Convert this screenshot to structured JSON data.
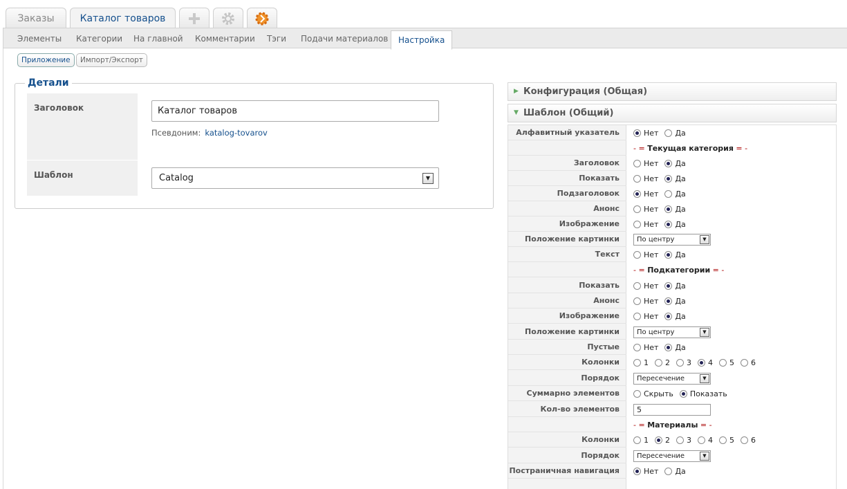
{
  "app_tabs": {
    "orders": "Заказы",
    "catalog": "Каталог товаров"
  },
  "subnav": [
    "Элементы",
    "Категории",
    "На главной",
    "Комментарии",
    "Тэги",
    "Подачи материалов",
    "Настройка"
  ],
  "pills": {
    "app": "Приложение",
    "import": "Импорт/Экспорт"
  },
  "details": {
    "legend": "Детали",
    "title_label": "Заголовок",
    "title_value": "Каталог товаров",
    "alias_label": "Псевдоним:",
    "alias_value": "katalog-tovarov",
    "template_label": "Шаблон",
    "template_value": "Catalog"
  },
  "accordion": {
    "config": "Конфигурация (Общая)",
    "template": "Шаблон (Общий)"
  },
  "sections": {
    "current": "Текущая категория",
    "sub": "Подкатегории",
    "materials": "Материалы"
  },
  "opts": {
    "no": "Нет",
    "yes": "Да",
    "hide": "Скрыть",
    "show": "Показать",
    "n1": "1",
    "n2": "2",
    "n3": "3",
    "n4": "4",
    "n5": "5",
    "n6": "6"
  },
  "params": {
    "alpha": "Алфавитный указатель",
    "title": "Заголовок",
    "show": "Показать",
    "subtitle": "Подзаголовок",
    "teaser": "Анонс",
    "image": "Изображение",
    "img_pos": "Положение картинки",
    "text": "Текст",
    "sub_show": "Показать",
    "sub_teaser": "Анонс",
    "sub_image": "Изображение",
    "sub_img_pos": "Положение картинки",
    "empty": "Пустые",
    "columns": "Колонки",
    "order": "Порядок",
    "total": "Суммарно элементов",
    "count": "Кол-во элементов",
    "mat_columns": "Колонки",
    "mat_order": "Порядок",
    "pagination": "Постраничная навигация"
  },
  "values": {
    "img_pos": "По центру",
    "order": "Пересечение",
    "count": "5"
  }
}
